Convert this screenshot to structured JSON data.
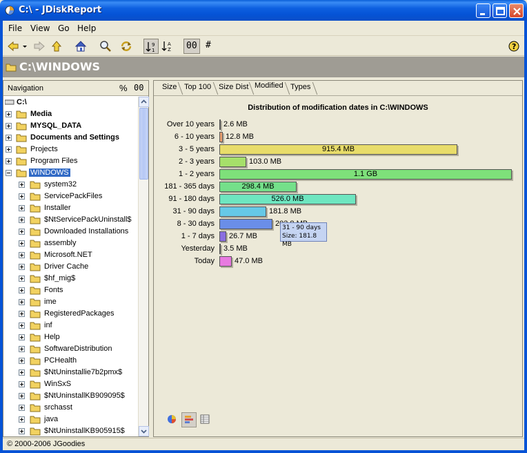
{
  "window": {
    "title": "C:\\ - JDiskReport"
  },
  "menubar": [
    "File",
    "View",
    "Go",
    "Help"
  ],
  "toolbar": {
    "view_buttons": [
      "00",
      "#"
    ]
  },
  "path_header": {
    "path": "C:\\WINDOWS"
  },
  "nav": {
    "header_label": "Navigation",
    "percent_label": "%",
    "size_label": "00",
    "root_label": "C:\\",
    "top_items": [
      {
        "label": "Media",
        "bold": true
      },
      {
        "label": "MYSQL_DATA",
        "bold": true
      },
      {
        "label": "Documents and Settings",
        "bold": true
      },
      {
        "label": "Projects",
        "bold": false
      },
      {
        "label": "Program Files",
        "bold": false
      },
      {
        "label": "WINDOWS",
        "bold": false,
        "selected": true
      }
    ],
    "windows_children": [
      "system32",
      "ServicePackFiles",
      "Installer",
      "$NtServicePackUninstall$",
      "Downloaded Installations",
      "assembly",
      "Microsoft.NET",
      "Driver Cache",
      "$hf_mig$",
      "Fonts",
      "ime",
      "RegisteredPackages",
      "inf",
      "Help",
      "SoftwareDistribution",
      "PCHealth",
      "$NtUninstallie7b2pmx$",
      "WinSxS",
      "$NtUninstallKB909095$",
      "srchasst",
      "java",
      "$NtUninstallKB905915$"
    ]
  },
  "tabs": [
    "Size",
    "Top 100",
    "Size Dist",
    "Modified",
    "Types"
  ],
  "active_tab": "Modified",
  "chart_data": {
    "type": "bar",
    "orientation": "horizontal",
    "title": "Distribution of modification dates in C:\\WINDOWS",
    "categories": [
      "Over 10 years",
      "6 - 10 years",
      "3 - 5 years",
      "2 - 3 years",
      "1 - 2 years",
      "181 - 365 days",
      "91 - 180 days",
      "31 - 90 days",
      "8 - 30 days",
      "1 - 7 days",
      "Yesterday",
      "Today"
    ],
    "values_mb": [
      2.6,
      12.8,
      915.4,
      103.0,
      1126.4,
      298.4,
      526.0,
      181.8,
      203.8,
      26.7,
      3.5,
      47.0
    ],
    "value_labels": [
      "2.6 MB",
      "12.8 MB",
      "915.4 MB",
      "103.0 MB",
      "1.1 GB",
      "298.4 MB",
      "526.0 MB",
      "181.8 MB",
      "203.8 MB",
      "26.7 MB",
      "3.5 MB",
      "47.0 MB"
    ],
    "colors": [
      "#8a8a8a",
      "#e8a070",
      "#e8dc6a",
      "#a6e06a",
      "#7ee07a",
      "#74e08a",
      "#6ee6c0",
      "#66c8e6",
      "#6a8ee8",
      "#8a6ee0",
      "#a8a8a8",
      "#e87ae0"
    ]
  },
  "tooltip": {
    "line1": "31 - 90 days",
    "line2": "Size: 181.8 MB"
  },
  "status_bar": {
    "text": "© 2000-2006 JGoodies"
  }
}
